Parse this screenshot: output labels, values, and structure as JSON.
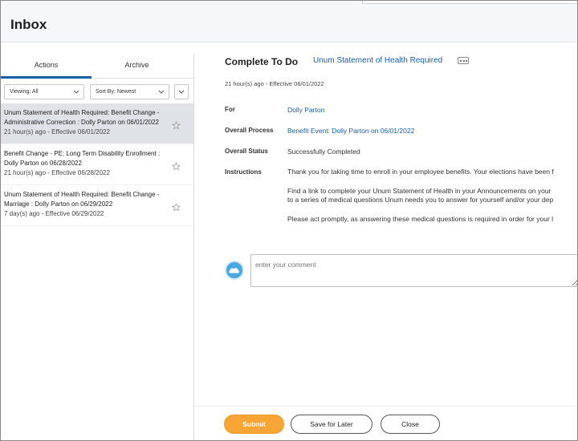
{
  "header": {
    "title": "Inbox"
  },
  "sidebar": {
    "tabs": [
      {
        "label": "Actions",
        "active": true
      },
      {
        "label": "Archive",
        "active": false
      }
    ],
    "filters": {
      "viewing": "Viewing: All",
      "sort": "Sort By: Newest"
    },
    "items": [
      {
        "line1": "Unum Statement of Health Required: Benefit Change -",
        "line2": "Administrative Correction : Dolly Parton on 06/01/2022",
        "meta": "21 hour(s) ago - Effective 06/01/2022",
        "selected": true
      },
      {
        "line1": "Benefit Change - PE: Long Term Disability Enrollment :",
        "line2": "Dolly Parton on 06/28/2022",
        "meta": "21 hour(s) ago - Effective 06/28/2022",
        "selected": false
      },
      {
        "line1": "Unum Statement of Health Required: Benefit Change -",
        "line2": "Marriage : Dolly Parton on 06/29/2022",
        "meta": "7 day(s) ago - Effective 06/29/2022",
        "selected": false
      }
    ]
  },
  "detail": {
    "heading": "Complete To Do",
    "heading_link": "Unum Statement of Health Required",
    "timestamp": "21 hour(s) ago - Effective 06/01/2022",
    "fields": {
      "for_label": "For",
      "for_value": "Dolly Parton",
      "process_label": "Overall Process",
      "process_value": "Benefit Event: Dolly Parton on 06/01/2022",
      "status_label": "Overall Status",
      "status_value": "Successfully Completed",
      "instructions_label": "Instructions"
    },
    "instructions": {
      "p1": "Thank you for taking time to enroll in your employee benefits. Your elections have been f",
      "p2a": "Find a link to complete your Unum Statement of Health in your Announcements on your",
      "p2b": "to a series of medical questions Unum needs you to answer for yourself and/or your dep",
      "p3": "Please act promptly, as answering these medical questions is required in order for your l"
    },
    "comment_placeholder": "enter your comment"
  },
  "footer": {
    "submit": "Submit",
    "save": "Save for Later",
    "close": "Close"
  },
  "colors": {
    "link": "#1a5ea7",
    "submit": "#f7a534",
    "selected_row": "#dfe3e8",
    "avatar": "#4aa8e0"
  }
}
